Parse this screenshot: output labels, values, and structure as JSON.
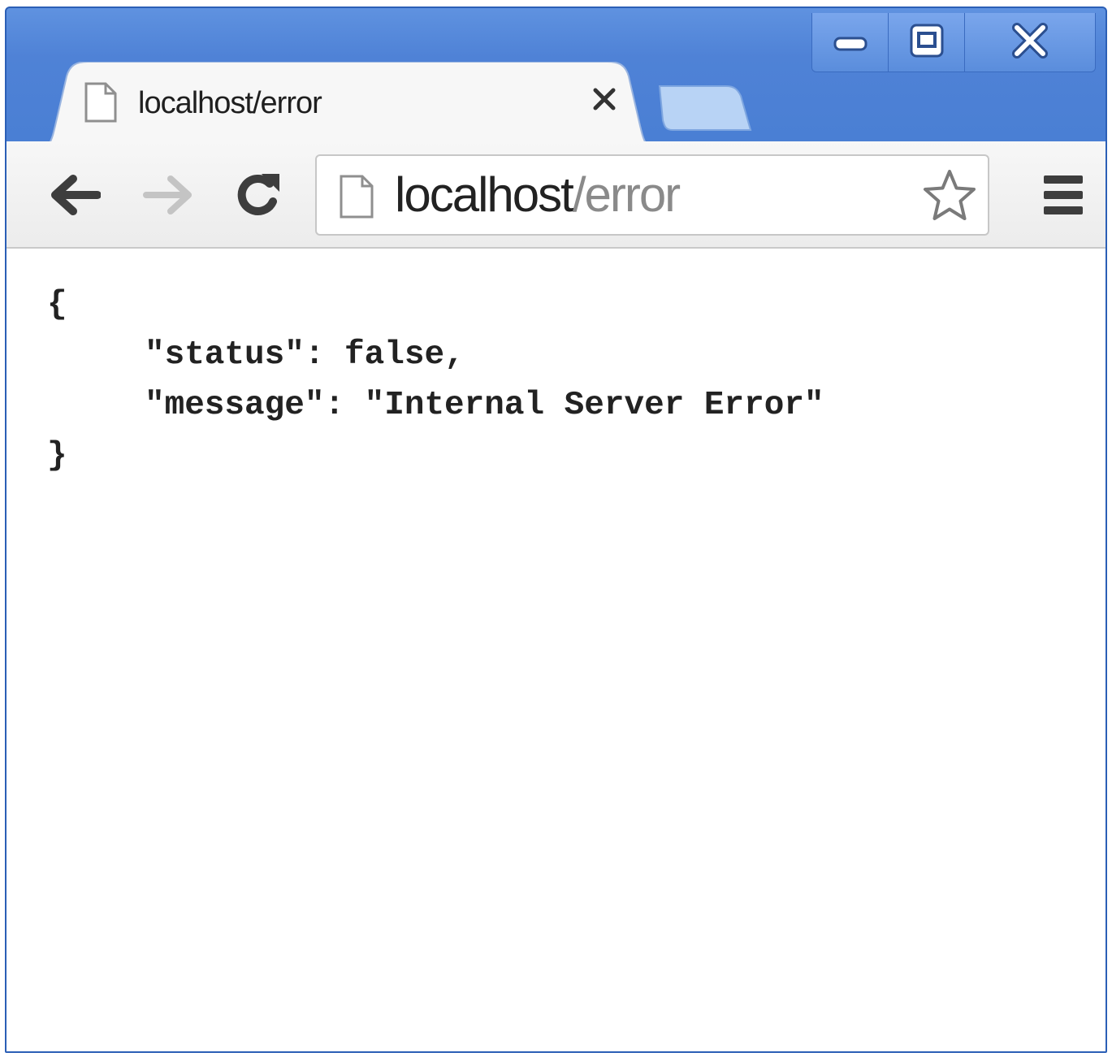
{
  "window": {
    "controls": [
      "minimize-icon",
      "maximize-icon",
      "close-icon"
    ]
  },
  "tab": {
    "title": "localhost/error",
    "close_label": "×",
    "icon": "page-icon"
  },
  "toolbar": {
    "back_icon": "back-arrow-icon",
    "forward_icon": "forward-arrow-icon",
    "reload_icon": "reload-icon",
    "bookmark_icon": "star-icon",
    "menu_icon": "hamburger-menu-icon"
  },
  "omnibox": {
    "host": "localhost",
    "path": "/error"
  },
  "content": {
    "open_brace": "{",
    "line1_key": "\"status\"",
    "line1_rest": ": false,",
    "line2_key": "\"message\"",
    "line2_rest": ": \"Internal Server Error\"",
    "close_brace": "}"
  },
  "colors": {
    "frame": "#4f82d6",
    "toolbar": "#f2f2f2",
    "url_host": "#222222",
    "url_path": "#8a8a8a"
  }
}
